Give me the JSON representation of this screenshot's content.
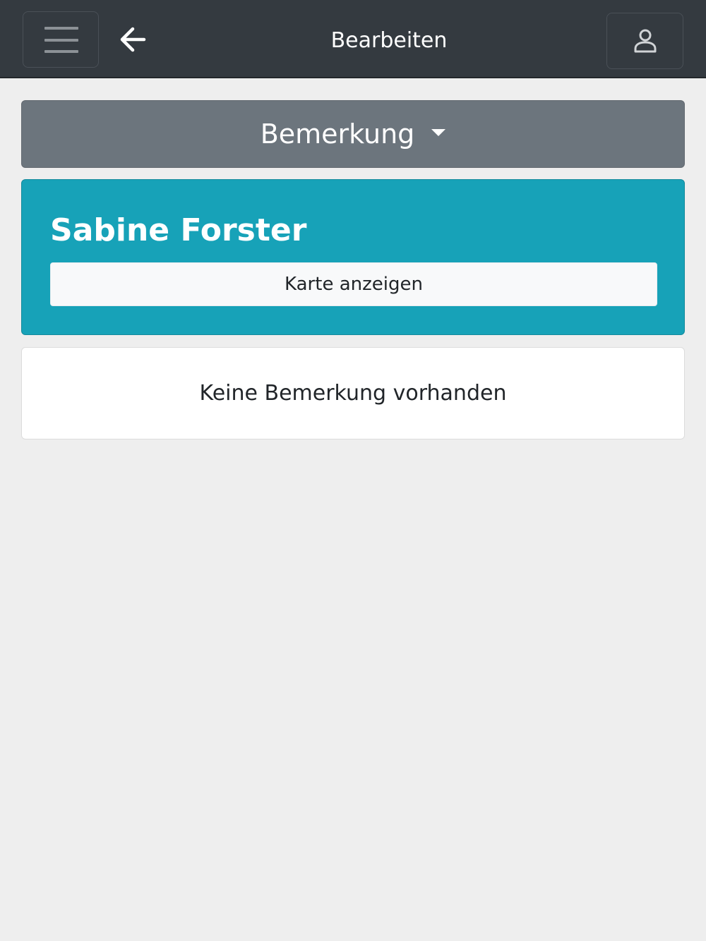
{
  "header": {
    "title": "Bearbeiten",
    "menu_icon": "hamburger-menu-icon",
    "back_icon": "arrow-left-icon",
    "user_icon": "user-icon",
    "background_color": "#343a40"
  },
  "section_selector": {
    "selected": "Bemerkung",
    "caret_icon": "caret-down-icon",
    "background_color": "#6c757d"
  },
  "person_card": {
    "name": "Sabine Forster",
    "map_button_label": "Karte anzeigen",
    "background_color": "#17a2b8"
  },
  "remarks": {
    "empty_text": "Keine Bemerkung vorhanden"
  }
}
